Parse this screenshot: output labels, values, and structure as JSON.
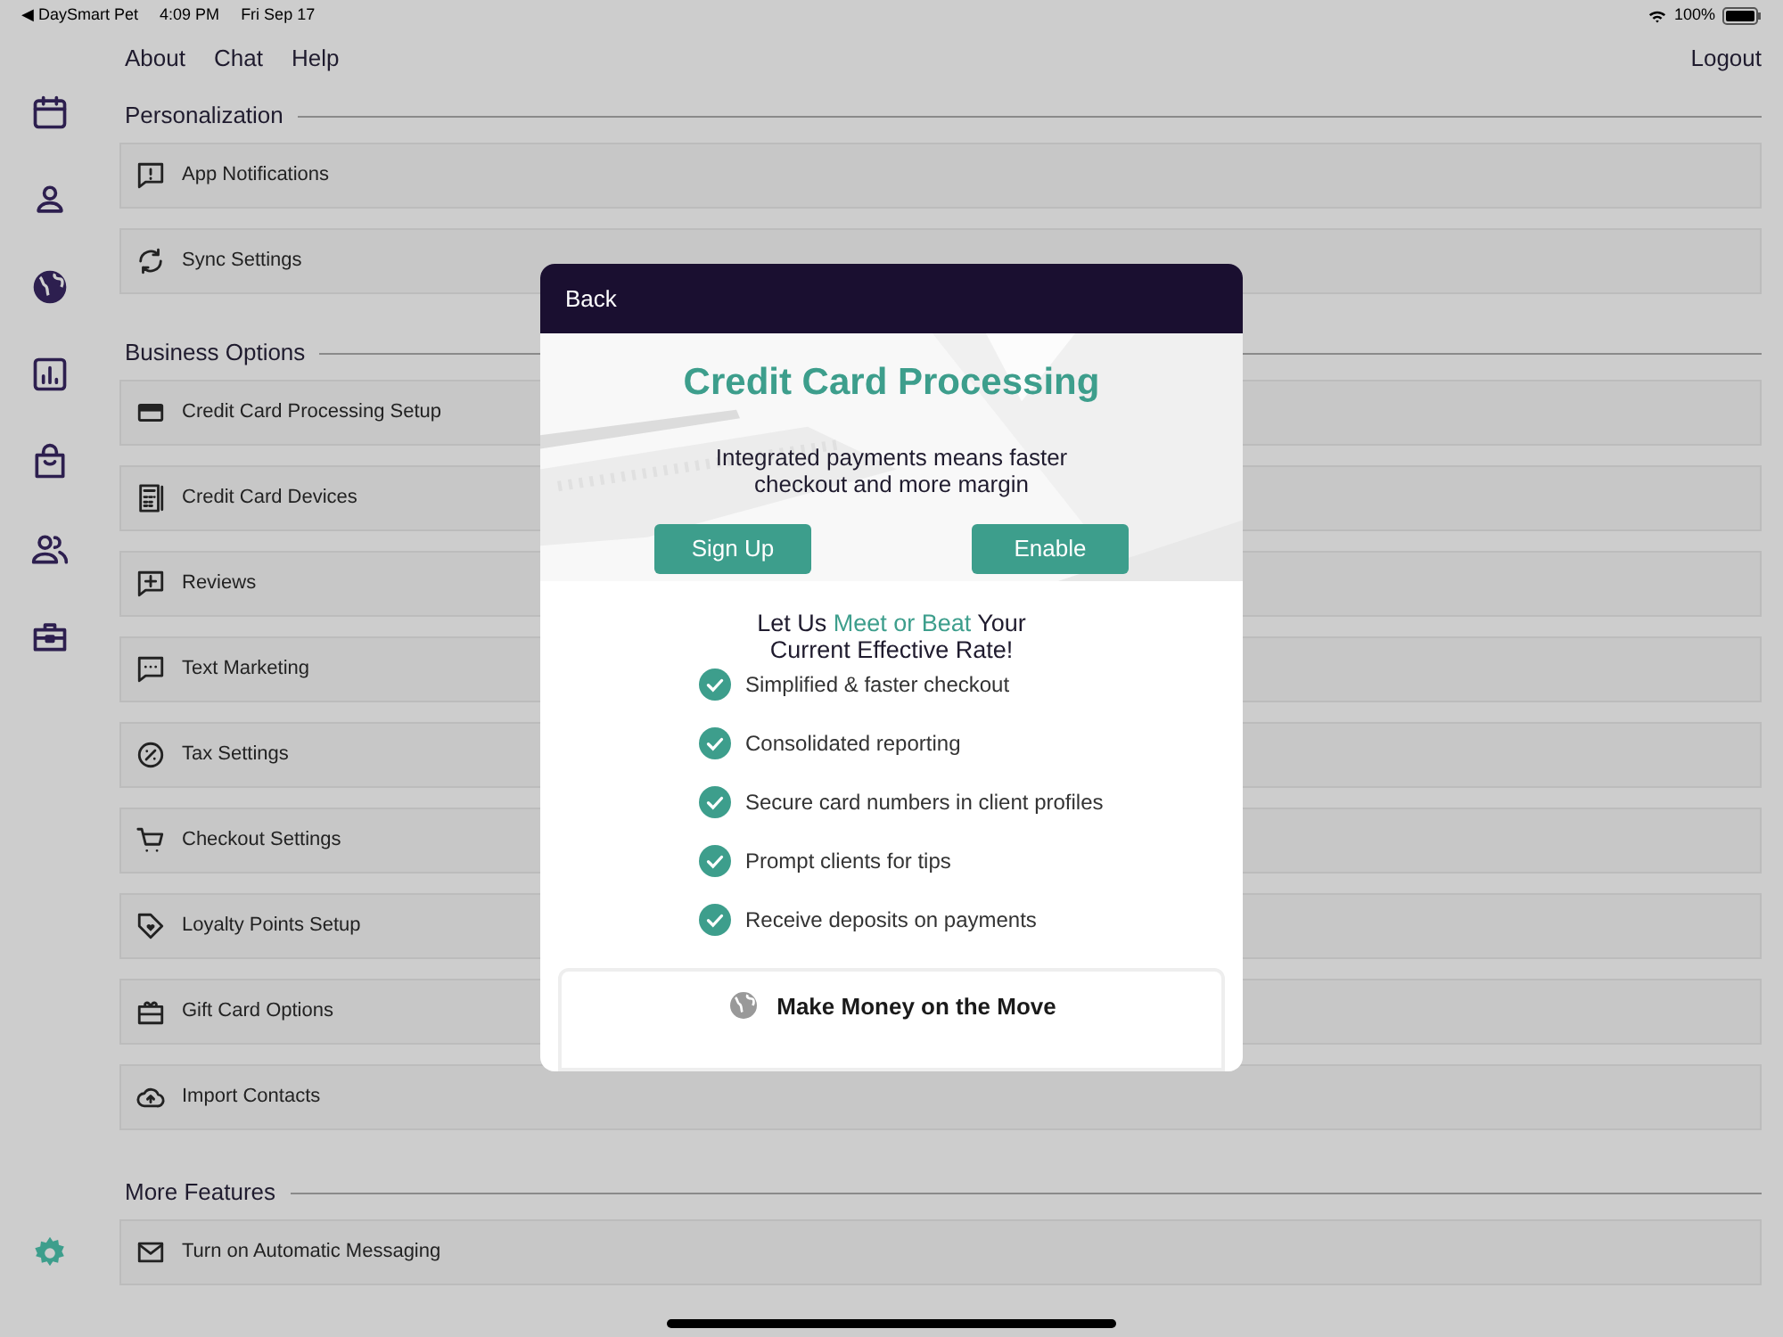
{
  "status_bar": {
    "back_app": "◀ DaySmart Pet",
    "time": "4:09 PM",
    "date": "Fri Sep 17",
    "battery": "100%"
  },
  "top_nav": {
    "links": [
      "About",
      "Chat",
      "Help"
    ],
    "logout": "Logout"
  },
  "sidebar": {
    "items": [
      {
        "selected": false
      },
      {
        "selected": false
      },
      {
        "selected": false
      },
      {
        "selected": false
      },
      {
        "selected": false
      },
      {
        "selected": false
      },
      {
        "selected": false
      }
    ],
    "settings": {
      "selected": true
    }
  },
  "sections": [
    {
      "title": "Personalization",
      "rows": [
        "App Notifications",
        "Sync Settings"
      ]
    },
    {
      "title": "Business Options",
      "rows": [
        "Credit Card Processing Setup",
        "Credit Card Devices",
        "Reviews",
        "Text Marketing",
        "Tax Settings",
        "Checkout Settings",
        "Loyalty Points Setup",
        "Gift Card Options",
        "Import Contacts"
      ]
    },
    {
      "title": "More Features",
      "rows": [
        "Turn on Automatic Messaging"
      ]
    }
  ],
  "modal": {
    "back": "Back",
    "title": "Credit Card Processing",
    "subtitle": "Integrated payments means faster checkout and more margin",
    "buttons": [
      "Sign Up",
      "Enable"
    ],
    "rate_heading": [
      {
        "text": "Let Us ",
        "accent": false
      },
      {
        "text": "Meet or Beat",
        "accent": true
      },
      {
        "text": " Your Current Effective Rate!",
        "accent": false
      }
    ],
    "benefits": [
      "Simplified & faster checkout",
      "Consolidated reporting",
      "Secure card numbers in client profiles",
      "Prompt clients for tips",
      "Receive deposits on payments"
    ],
    "card_title": "Make Money on the Move"
  }
}
